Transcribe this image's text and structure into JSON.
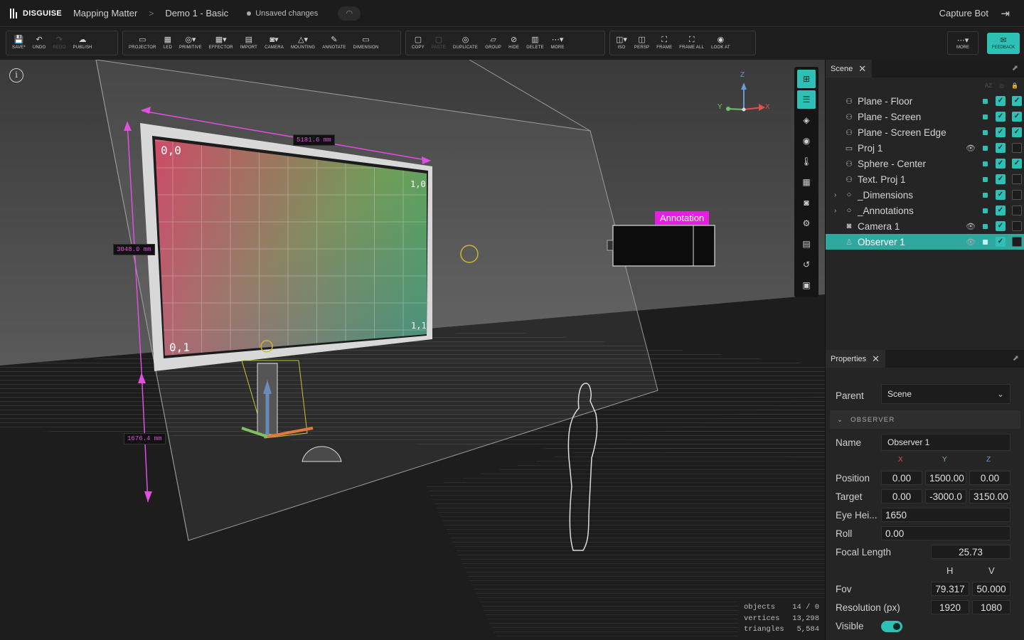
{
  "app": {
    "brand": "DISGUISE",
    "project": "Mapping Matter",
    "sep": ">",
    "document": "Demo 1 - Basic",
    "status": "Unsaved changes",
    "user": "Capture Bot"
  },
  "toolbar": {
    "group1": [
      {
        "icon": "💾",
        "label": "SAVE*"
      },
      {
        "icon": "↶",
        "label": "UNDO"
      },
      {
        "icon": "↷",
        "label": "REDO"
      },
      {
        "icon": "☁",
        "label": "PUBLISH"
      }
    ],
    "group2": [
      {
        "icon": "▭",
        "label": "PROJECTOR"
      },
      {
        "icon": "▦",
        "label": "LED"
      },
      {
        "icon": "◎▾",
        "label": "PRIMITIVE"
      },
      {
        "icon": "▦▾",
        "label": "EFFECTOR"
      },
      {
        "icon": "▤",
        "label": "IMPORT"
      },
      {
        "icon": "◙▾",
        "label": "CAMERA"
      },
      {
        "icon": "△▾",
        "label": "MOUNTING"
      },
      {
        "icon": "✎",
        "label": "ANNOTATE"
      },
      {
        "icon": "▭",
        "label": "DIMENSION"
      }
    ],
    "group3": [
      {
        "icon": "▢",
        "label": "COPY"
      },
      {
        "icon": "▢",
        "label": "PASTE"
      },
      {
        "icon": "◎",
        "label": "DUPLICATE"
      },
      {
        "icon": "▱",
        "label": "GROUP"
      },
      {
        "icon": "⊘",
        "label": "HIDE"
      },
      {
        "icon": "▥",
        "label": "DELETE"
      },
      {
        "icon": "⋯▾",
        "label": "MORE"
      }
    ],
    "group4": [
      {
        "icon": "◫▾",
        "label": "ISO"
      },
      {
        "icon": "◫",
        "label": "PERSP"
      },
      {
        "icon": "⛶",
        "label": "FRAME"
      },
      {
        "icon": "⛶",
        "label": "FRAME ALL"
      },
      {
        "icon": "◉",
        "label": "LOOK AT"
      }
    ],
    "more": {
      "icon": "⋯▾",
      "label": "MORE"
    },
    "feedback": {
      "icon": "✉",
      "label": "FEEDBACK"
    }
  },
  "viewport": {
    "dim_width": "5181.6 mm",
    "dim_height": "3048.0 mm",
    "dim_lower": "1676.4 mm",
    "annotation": "Annotation",
    "corner_tl": "0,0",
    "corner_tr": "1,0",
    "corner_bl": "0,1",
    "corner_br": "1,1",
    "axis": {
      "z": "Z",
      "y": "Y",
      "x": "X"
    },
    "stats": {
      "objects_label": "objects",
      "objects": "14 / 0",
      "vertices_label": "vertices",
      "vertices": "13,298",
      "triangles_label": "triangles",
      "triangles": "5,584"
    }
  },
  "scene_panel": {
    "tab": "Scene",
    "items": [
      {
        "name": "Plane - Floor",
        "icon": "⚇",
        "eye": "",
        "a": true,
        "b": true,
        "expand": "",
        "selected": false
      },
      {
        "name": "Plane - Screen",
        "icon": "⚇",
        "eye": "",
        "a": true,
        "b": true,
        "expand": "",
        "selected": false
      },
      {
        "name": "Plane - Screen Edge",
        "icon": "⚇",
        "eye": "",
        "a": true,
        "b": true,
        "expand": "",
        "selected": false
      },
      {
        "name": "Proj 1",
        "icon": "▭",
        "eye": "👁",
        "a": true,
        "b": false,
        "expand": "",
        "selected": false
      },
      {
        "name": "Sphere - Center",
        "icon": "⚇",
        "eye": "",
        "a": true,
        "b": true,
        "expand": "",
        "selected": false
      },
      {
        "name": "Text. Proj 1",
        "icon": "⚇",
        "eye": "",
        "a": true,
        "b": false,
        "expand": "",
        "selected": false
      },
      {
        "name": "_Dimensions",
        "icon": "○",
        "eye": "",
        "a": true,
        "b": false,
        "expand": "›",
        "selected": false
      },
      {
        "name": "_Annotations",
        "icon": "○",
        "eye": "",
        "a": true,
        "b": false,
        "expand": "›",
        "selected": false
      },
      {
        "name": "Camera 1",
        "icon": "◙",
        "eye": "👁",
        "a": true,
        "b": false,
        "expand": "",
        "selected": false
      },
      {
        "name": "Observer 1",
        "icon": "♙",
        "eye": "👁",
        "a": true,
        "b": false,
        "expand": "",
        "selected": true
      }
    ]
  },
  "properties": {
    "tab": "Properties",
    "parent_label": "Parent",
    "parent_value": "Scene",
    "section": "OBSERVER",
    "name_label": "Name",
    "name_value": "Observer 1",
    "axes": {
      "x": "X",
      "y": "Y",
      "z": "Z"
    },
    "position_label": "Position",
    "position": [
      "0.00",
      "1500.00",
      "0.00"
    ],
    "target_label": "Target",
    "target": [
      "0.00",
      "-3000.0",
      "3150.00"
    ],
    "eye_label": "Eye Hei...",
    "eye_value": "1650",
    "roll_label": "Roll",
    "roll_value": "0.00",
    "focal_label": "Focal Length",
    "focal_value": "25.73",
    "h": "H",
    "v": "V",
    "fov_label": "Fov",
    "fov": [
      "79.317",
      "50.000"
    ],
    "res_label": "Resolution (px)",
    "res": [
      "1920",
      "1080"
    ],
    "visible_label": "Visible",
    "visible": true
  },
  "colors": {
    "accent": "#2fc0b5",
    "annotation": "#e81ce2",
    "dimension": "#e04fe0"
  }
}
